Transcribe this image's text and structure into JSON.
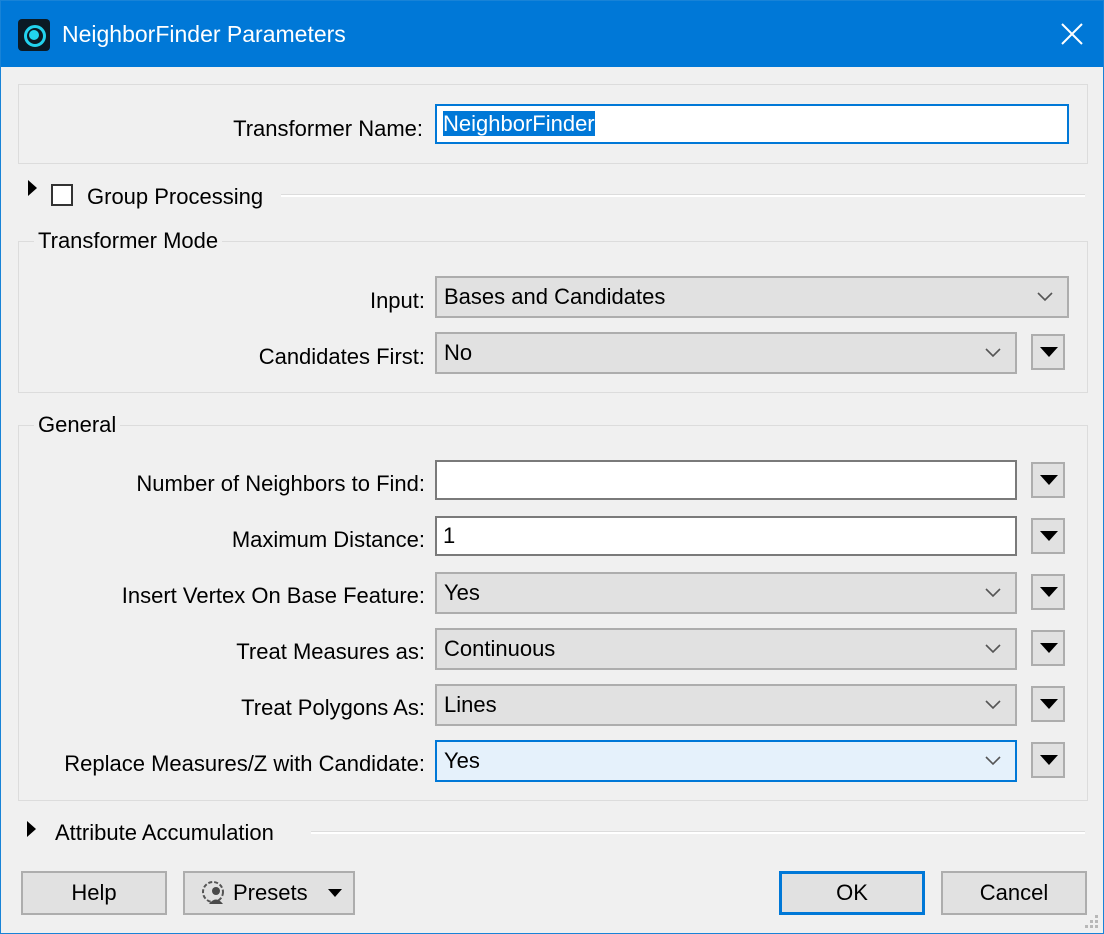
{
  "window": {
    "title": "NeighborFinder Parameters",
    "app_icon": "fme-transformer-icon",
    "close_icon": "close-icon"
  },
  "transformer_name": {
    "label": "Transformer Name:",
    "value": "NeighborFinder",
    "selected": true
  },
  "group_processing": {
    "label": "Group Processing",
    "checked": false,
    "expanded": false
  },
  "transformer_mode": {
    "title": "Transformer Mode",
    "input": {
      "label": "Input:",
      "value": "Bases and Candidates"
    },
    "candidates_first": {
      "label": "Candidates First:",
      "value": "No"
    }
  },
  "general": {
    "title": "General",
    "fields": [
      {
        "label": "Number of Neighbors to Find:",
        "value": "",
        "type": "text"
      },
      {
        "label": "Maximum Distance:",
        "value": "1",
        "type": "text"
      },
      {
        "label": "Insert Vertex On Base Feature:",
        "value": "Yes",
        "type": "combo"
      },
      {
        "label": "Treat Measures as:",
        "value": "Continuous",
        "type": "combo"
      },
      {
        "label": "Treat Polygons As:",
        "value": "Lines",
        "type": "combo"
      },
      {
        "label": "Replace Measures/Z with Candidate:",
        "value": "Yes",
        "type": "combo",
        "focused": true
      }
    ]
  },
  "attribute_accumulation": {
    "label": "Attribute Accumulation",
    "expanded": false
  },
  "footer": {
    "help": "Help",
    "presets": "Presets",
    "ok": "OK",
    "cancel": "Cancel"
  },
  "colors": {
    "accent": "#0078d7",
    "titlebar": "#0078d7",
    "focused_combo_bg": "#e5f1fb"
  }
}
